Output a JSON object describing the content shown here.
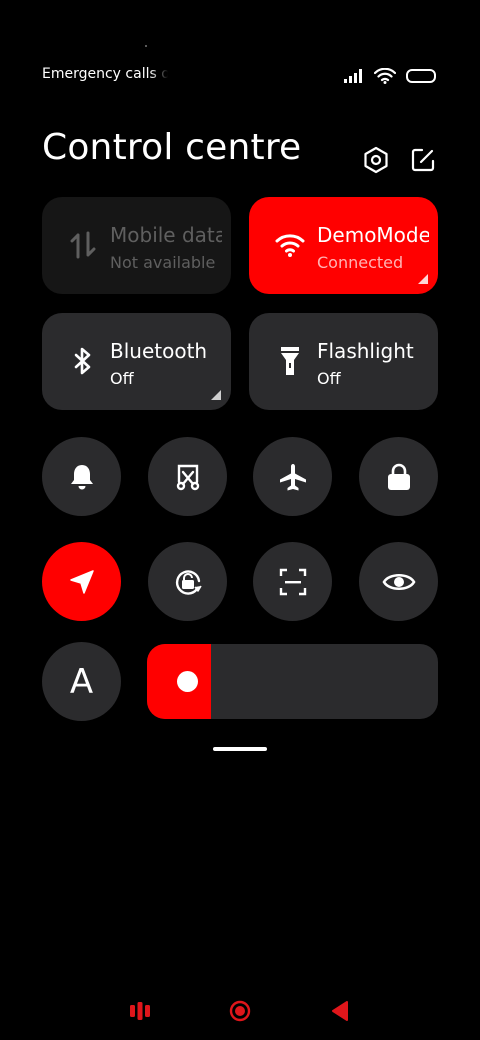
{
  "status_bar": {
    "text": "Emergency calls only"
  },
  "header": {
    "title": "Control centre",
    "settings_icon": "hexagon-settings-icon",
    "edit_icon": "edit-icon"
  },
  "tiles": {
    "mobile_data": {
      "title": "Mobile data",
      "subtitle": "Not available"
    },
    "wifi": {
      "title": "DemoMode",
      "subtitle": "Connected"
    },
    "bluetooth": {
      "title": "Bluetooth",
      "subtitle": "Off"
    },
    "flashlight": {
      "title": "Flashlight",
      "subtitle": "Off"
    }
  },
  "round_buttons": {
    "font_label": "A"
  },
  "brightness": {
    "level": 0.22
  },
  "colors": {
    "accent": "#ff0000",
    "tile_bg": "#2b2b2d",
    "tile_disabled": "#161616"
  }
}
